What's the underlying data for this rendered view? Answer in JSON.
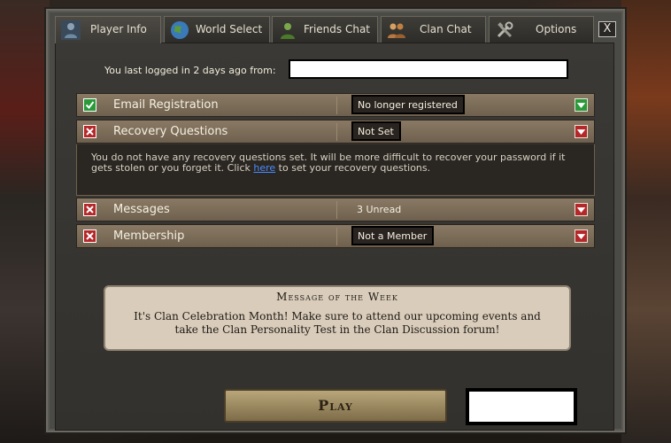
{
  "tabs": [
    {
      "label": "Player Info",
      "icon": "player-icon",
      "active": true
    },
    {
      "label": "World Select",
      "icon": "globe-icon",
      "active": false
    },
    {
      "label": "Friends Chat",
      "icon": "friends-icon",
      "active": false
    },
    {
      "label": "Clan Chat",
      "icon": "clan-icon",
      "active": false
    },
    {
      "label": "Options",
      "icon": "tools-icon",
      "active": false
    }
  ],
  "close_label": "X",
  "last_login": {
    "text": "You last logged in 2 days ago from:",
    "ip_value": ""
  },
  "rows": [
    {
      "label": "Email Registration",
      "status": "No longer registered",
      "state": "ok"
    },
    {
      "label": "Recovery Questions",
      "status": "Not Set",
      "state": "bad"
    },
    {
      "label": "Messages",
      "status": "3 Unread",
      "state": "bad"
    },
    {
      "label": "Membership",
      "status": "Not a Member",
      "state": "bad"
    }
  ],
  "recovery_info": {
    "text_before": "You do not have any recovery questions set. It will be more difficult to recover your password if it gets stolen or you forget it. Click ",
    "link": "here",
    "text_after": " to set your recovery questions."
  },
  "motw": {
    "title": "Message of the Week",
    "body": "It's Clan Celebration Month! Make sure to attend our upcoming events and take the Clan Personality Test in the Clan Discussion forum!"
  },
  "play_label": "Play",
  "colors": {
    "ok": "#2a9a3a",
    "bad": "#b4282a",
    "link": "#4a8cff"
  }
}
